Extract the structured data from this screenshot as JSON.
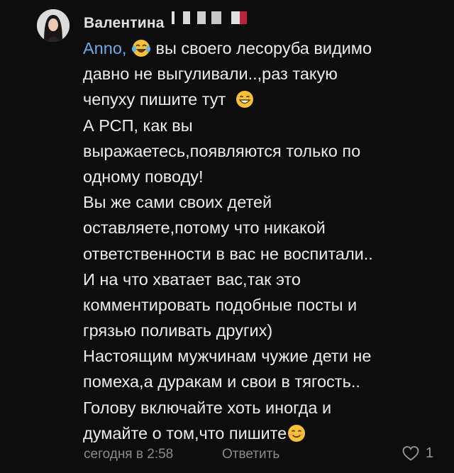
{
  "comment": {
    "author": "Валентина",
    "mention": "Anno,",
    "lines": [
      "вы своего лесоруба видимо",
      "давно не выгуливали..,раз такую",
      "чепуху пишите тут",
      "А РСП, как вы",
      "выражаетесь,появляются только  по",
      "одному поводу!",
      "Вы же сами своих детей",
      "оставляете,потому что никакой",
      "ответственности в вас не воспитали..",
      "И на что хватает вас,так это",
      "комментировать подобные посты и",
      "грязью поливать других)",
      "Настоящим мужчинам чужие дети не",
      "помеха,а дуракам и свои в тягость..",
      "Голову включайте хоть иногда и",
      "думайте о том,что пишите"
    ],
    "timestamp": "сегодня в 2:58",
    "reply_label": "Ответить",
    "like_count": "1",
    "icons": {
      "avatar": "avatar-photo",
      "laugh_emoji": "tears-of-joy-emoji",
      "grin_emoji": "grinning-emoji",
      "smile_emoji": "smiling-emoji",
      "like": "heart-outline-icon"
    },
    "colors": {
      "background": "#0d0d0d",
      "text": "#ececec",
      "mention": "#6fa8e8",
      "meta": "#8a8a8a",
      "emoji": "#f6c233"
    }
  }
}
